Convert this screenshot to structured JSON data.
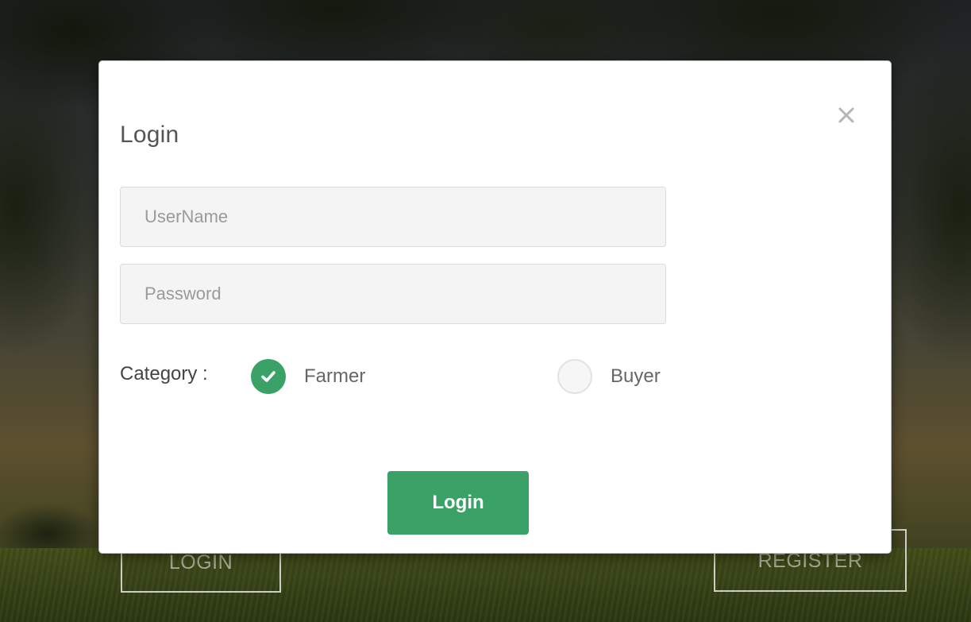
{
  "background": {
    "login_button": "LOGIN",
    "register_button": "REGISTER"
  },
  "modal": {
    "title": "Login",
    "close_icon": "close-icon",
    "username_placeholder": "UserName",
    "password_placeholder": "Password",
    "category_label": "Category :",
    "category_options": [
      {
        "label": "Farmer",
        "selected": true
      },
      {
        "label": "Buyer",
        "selected": false
      }
    ],
    "submit_label": "Login"
  },
  "colors": {
    "accent": "#3aa266"
  }
}
